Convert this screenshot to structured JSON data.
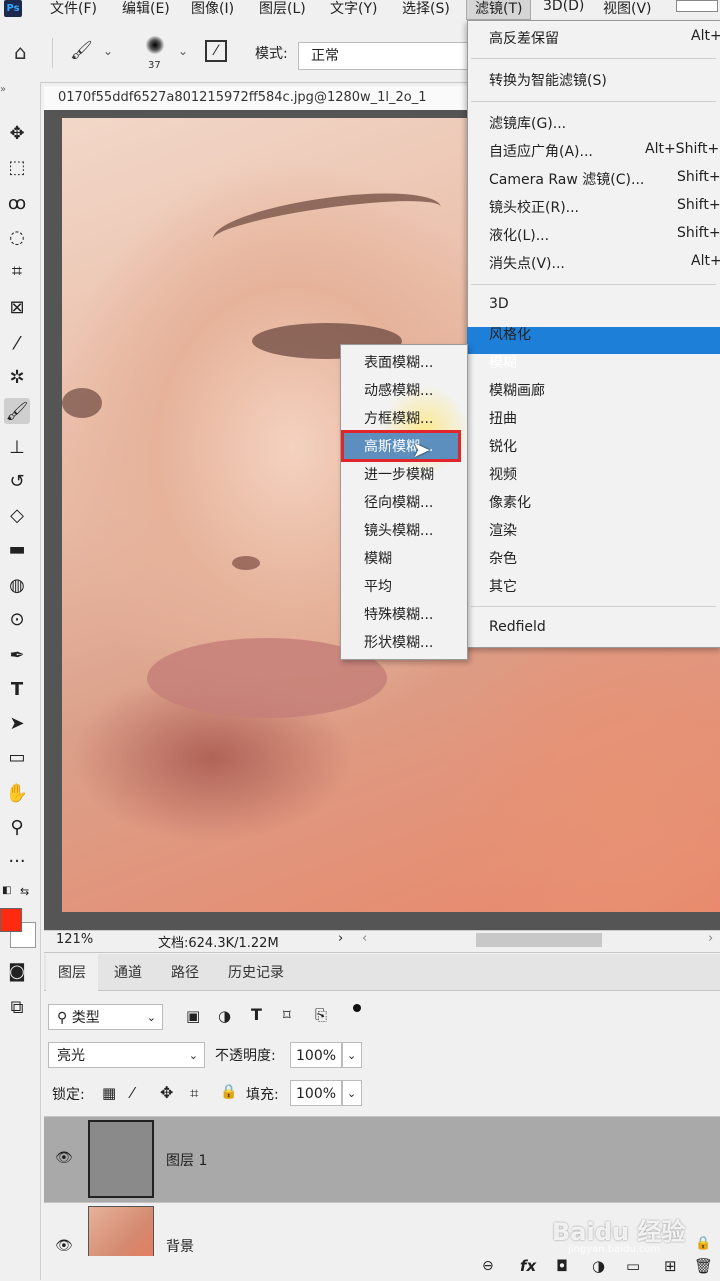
{
  "menubar": {
    "items": [
      "文件(F)",
      "编辑(E)",
      "图像(I)",
      "图层(L)",
      "文字(Y)",
      "选择(S)",
      "滤镜(T)",
      "3D(D)",
      "视图(V)"
    ],
    "active": "滤镜(T)",
    "logo": "Ps"
  },
  "options": {
    "brush_size": "37",
    "mode_label": "模式:",
    "mode_value": "正常"
  },
  "document": {
    "tab_title": "0170f55ddf6527a801215972ff584c.jpg@1280w_1l_2o_1"
  },
  "statusbar": {
    "zoom": "121%",
    "doc_info": "文档:624.3K/1.22M",
    "arrow": "›",
    "scroll_left": "‹",
    "scroll_right": "›"
  },
  "filter_menu": {
    "top_items": [
      {
        "label": "高反差保留",
        "shortcut": "Alt+"
      },
      {
        "label": "转换为智能滤镜(S)",
        "shortcut": ""
      }
    ],
    "main_items": [
      {
        "label": "滤镜库(G)...",
        "shortcut": ""
      },
      {
        "label": "自适应广角(A)...",
        "shortcut": "Alt+Shift+"
      },
      {
        "label": "Camera Raw 滤镜(C)...",
        "shortcut": "Shift+"
      },
      {
        "label": "镜头校正(R)...",
        "shortcut": "Shift+"
      },
      {
        "label": "液化(L)...",
        "shortcut": "Shift+"
      },
      {
        "label": "消失点(V)...",
        "shortcut": "Alt+"
      }
    ],
    "categories": [
      "3D",
      "风格化",
      "模糊",
      "模糊画廊",
      "扭曲",
      "锐化",
      "视频",
      "像素化",
      "渲染",
      "杂色",
      "其它"
    ],
    "highlighted": "模糊",
    "plugin": "Redfield"
  },
  "blur_submenu": {
    "items": [
      "表面模糊...",
      "动感模糊...",
      "方框模糊...",
      "高斯模糊...",
      "进一步模糊",
      "径向模糊...",
      "镜头模糊...",
      "模糊",
      "平均",
      "特殊模糊...",
      "形状模糊..."
    ],
    "highlighted": "高斯模糊..."
  },
  "layers_panel": {
    "tabs": [
      "图层",
      "通道",
      "路径",
      "历史记录"
    ],
    "active_tab": "图层",
    "filter_kind": "类型",
    "blend_mode": "亮光",
    "opacity_label": "不透明度:",
    "opacity_value": "100%",
    "lock_label": "锁定:",
    "fill_label": "填充:",
    "fill_value": "100%",
    "layers": [
      {
        "name": "图层 1",
        "selected": true
      },
      {
        "name": "背景",
        "selected": false
      }
    ],
    "footer_icons": [
      "link-icon",
      "fx-icon",
      "mask-icon",
      "adjustment-icon",
      "folder-icon",
      "new-layer-icon",
      "trash-icon"
    ],
    "fx_label": "fx"
  },
  "colors": {
    "foreground": "#ff2a10",
    "background": "#ffffff",
    "highlight": "#1e7fd8",
    "red_box": "#e0262b"
  },
  "watermark": {
    "text": "Baidu 经验",
    "sub": "jingyan.baidu.com"
  }
}
